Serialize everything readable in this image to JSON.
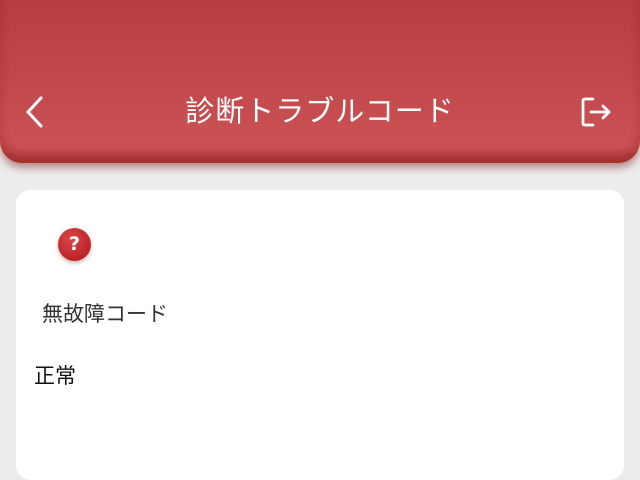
{
  "header": {
    "title": "診断トラブルコード"
  },
  "icons": {
    "back": "chevron-left-icon",
    "logout": "logout-icon",
    "help": "question-icon"
  },
  "card": {
    "help_symbol": "?",
    "code_label": "無故障コード",
    "code_value": "正常"
  },
  "colors": {
    "header_red": "#c24a4c",
    "icon_red": "#c0282c",
    "background": "#ececec"
  }
}
